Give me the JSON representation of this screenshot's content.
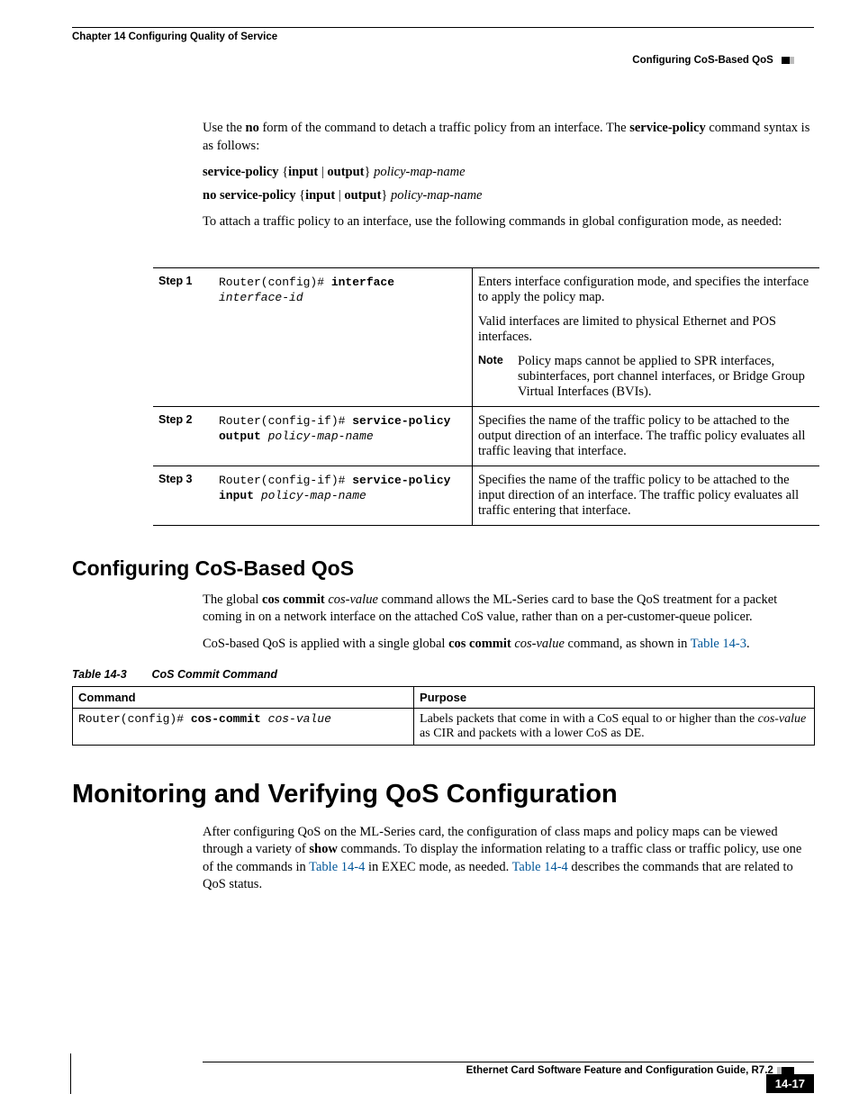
{
  "header": {
    "chapter": "Chapter 14 Configuring Quality of Service",
    "section": "Configuring CoS-Based QoS"
  },
  "intro": {
    "p1_a": "Use the ",
    "p1_b": "no",
    "p1_c": " form of the command to detach a traffic policy from an interface. The ",
    "p1_d": "service-policy",
    "p1_e": " command syntax is as follows:",
    "syntax1_a": "service-policy",
    "syntax1_b": " {",
    "syntax1_c": "input",
    "syntax1_d": " | ",
    "syntax1_e": "output",
    "syntax1_f": "} ",
    "syntax1_g": "policy-map-name",
    "syntax2_a": "no service-policy",
    "syntax2_b": " {",
    "syntax2_c": "input",
    "syntax2_d": " | ",
    "syntax2_e": "output",
    "syntax2_f": "} ",
    "syntax2_g": "policy-map-name",
    "p3": "To attach a traffic policy to an interface, use the following commands in global configuration mode, as needed:"
  },
  "steps": [
    {
      "label": "Step 1",
      "cmd_prefix": "Router(config)# ",
      "cmd_bold": "interface",
      "cmd_arg": "interface-id",
      "desc1": "Enters interface configuration mode, and specifies the interface to apply the policy map.",
      "desc2": "Valid interfaces are limited to physical Ethernet and POS interfaces.",
      "note_label": "Note",
      "note_text": "Policy maps cannot be applied to SPR interfaces, subinterfaces, port channel interfaces, or Bridge Group Virtual Interfaces (BVIs)."
    },
    {
      "label": "Step 2",
      "cmd_prefix": "Router(config-if)# ",
      "cmd_bold": "service-policy output",
      "cmd_arg": "policy-map-name",
      "desc1": "Specifies the name of the traffic policy to be attached to the output direction of an interface. The traffic policy evaluates all traffic leaving that interface."
    },
    {
      "label": "Step 3",
      "cmd_prefix": "Router(config-if)# ",
      "cmd_bold": "service-policy input",
      "cmd_arg": "policy-map-name",
      "desc1": "Specifies the name of the traffic policy to be attached to the input direction of an interface. The traffic policy evaluates all traffic entering that interface."
    }
  ],
  "cos": {
    "heading": "Configuring CoS-Based QoS",
    "p1_a": "The global ",
    "p1_b": "cos commit",
    "p1_c": " ",
    "p1_d": "cos-value",
    "p1_e": " command allows the ML-Series card to base the QoS treatment for a packet coming in on a network interface on the attached CoS value, rather than on a per-customer-queue policer.",
    "p2_a": "CoS-based QoS is applied with a single global ",
    "p2_b": "cos commit",
    "p2_c": " ",
    "p2_d": "cos-value",
    "p2_e": " command, as shown in ",
    "p2_link": "Table 14-3",
    "p2_f": ".",
    "table_caption_num": "Table 14-3",
    "table_caption_text": "CoS Commit Command",
    "th1": "Command",
    "th2": "Purpose",
    "row_cmd_prefix": "Router(config)# ",
    "row_cmd_bold": "cos-commit",
    "row_cmd_arg": "cos-value",
    "row_purpose_a": "Labels packets that come in with a CoS equal to or higher than the ",
    "row_purpose_b": "cos-value",
    "row_purpose_c": " as CIR and packets with a lower CoS as DE."
  },
  "monitor": {
    "heading": "Monitoring and Verifying QoS Configuration",
    "p1_a": "After configuring QoS on the ML-Series card, the configuration of class maps and policy maps can be viewed through a variety of ",
    "p1_b": "show",
    "p1_c": " commands. To display the information relating to a traffic class or traffic policy, use one of the commands in ",
    "p1_link1": "Table 14-4",
    "p1_d": " in EXEC mode, as needed. ",
    "p1_link2": "Table 14-4",
    "p1_e": " describes the commands that are related to QoS status."
  },
  "footer": {
    "title": "Ethernet Card Software Feature and Configuration Guide, R7.2",
    "page": "14-17"
  }
}
